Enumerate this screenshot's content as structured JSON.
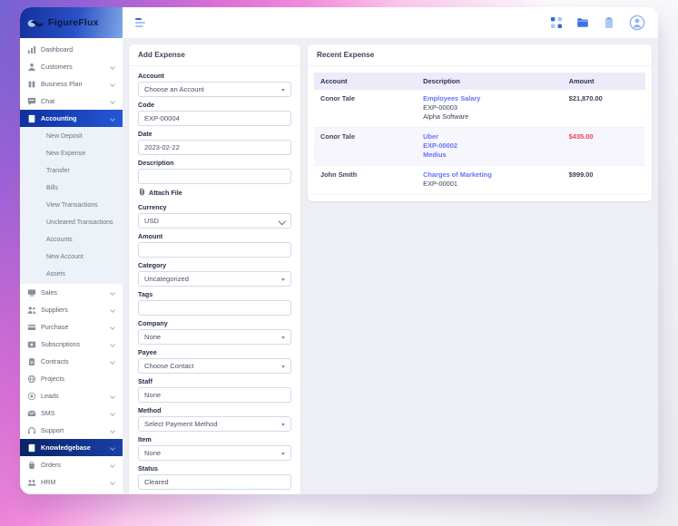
{
  "header": {
    "logo_text": "FigureFlux",
    "toolbar_icons": [
      "apps-icon",
      "folder-icon",
      "clipboard-icon",
      "profile-icon"
    ]
  },
  "sidebar": {
    "items": [
      {
        "label": "Dashboard",
        "icon": "chart-bar-icon",
        "expandable": false
      },
      {
        "label": "Customers",
        "icon": "user-icon",
        "expandable": true
      },
      {
        "label": "Business Plan",
        "icon": "columns-icon",
        "expandable": true
      },
      {
        "label": "Chat",
        "icon": "chat-icon",
        "expandable": true
      },
      {
        "label": "Accounting",
        "icon": "calculator-icon",
        "expandable": true,
        "active": true,
        "children": [
          "New Deposit",
          "New Expense",
          "Transfer",
          "Bills",
          "View Transactions",
          "Uncleared Transactions",
          "Accounts",
          "New Account",
          "Assets"
        ]
      },
      {
        "label": "Sales",
        "icon": "monitor-icon",
        "expandable": true
      },
      {
        "label": "Suppliers",
        "icon": "people-icon",
        "expandable": true
      },
      {
        "label": "Purchase",
        "icon": "credit-card-icon",
        "expandable": true
      },
      {
        "label": "Subscriptions",
        "icon": "screen-icon",
        "expandable": true
      },
      {
        "label": "Contracts",
        "icon": "clipboard-check-icon",
        "expandable": true
      },
      {
        "label": "Projects",
        "icon": "globe-icon",
        "expandable": false
      },
      {
        "label": "Leads",
        "icon": "target-icon",
        "expandable": true
      },
      {
        "label": "SMS",
        "icon": "envelope-icon",
        "expandable": true
      },
      {
        "label": "Support",
        "icon": "headset-icon",
        "expandable": true
      },
      {
        "label": "Knowledgebase",
        "icon": "book-icon",
        "expandable": true,
        "active": true,
        "variant": "dark"
      },
      {
        "label": "Orders",
        "icon": "bag-icon",
        "expandable": true
      },
      {
        "label": "HRM",
        "icon": "team-icon",
        "expandable": true
      }
    ]
  },
  "form": {
    "title": "Add Expense",
    "fields": [
      {
        "label": "Account",
        "control": "select",
        "value": "Choose an Account"
      },
      {
        "label": "Code",
        "control": "input",
        "value": "EXP-00004"
      },
      {
        "label": "Date",
        "control": "input",
        "value": "2023-02-22"
      },
      {
        "label": "Description",
        "control": "input",
        "value": ""
      },
      {
        "label": "Attach File",
        "control": "attach",
        "icon": "paperclip-icon"
      },
      {
        "label": "Currency",
        "control": "select2",
        "value": "USD"
      },
      {
        "label": "Amount",
        "control": "input",
        "value": ""
      },
      {
        "label": "Category",
        "control": "select",
        "value": "Uncategorized"
      },
      {
        "label": "Tags",
        "control": "input",
        "value": ""
      },
      {
        "label": "Company",
        "control": "select",
        "value": "None"
      },
      {
        "label": "Payee",
        "control": "select",
        "value": "Choose Contact"
      },
      {
        "label": "Staff",
        "control": "input",
        "value": "None"
      },
      {
        "label": "Method",
        "control": "select",
        "value": "Select Payment Method"
      },
      {
        "label": "Item",
        "control": "select",
        "value": "None"
      },
      {
        "label": "Status",
        "control": "input",
        "value": "Cleared"
      }
    ]
  },
  "recent": {
    "title": "Recent Expense",
    "columns": [
      "Account",
      "Description",
      "Amount"
    ],
    "rows": [
      {
        "account": "Conor Tale",
        "description_lines": [
          {
            "text": "Employees Salary",
            "link": true
          },
          {
            "text": "EXP-00003",
            "link": false
          },
          {
            "text": "Alpha Software",
            "link": false
          }
        ],
        "amount": "$21,870.00",
        "negative": false
      },
      {
        "account": "Conor Tale",
        "description_lines": [
          {
            "text": "Uber",
            "link": true
          },
          {
            "text": "EXP-00002",
            "link": true
          },
          {
            "text": "Medius",
            "link": true
          }
        ],
        "amount": "$435.00",
        "negative": true
      },
      {
        "account": "John Smith",
        "description_lines": [
          {
            "text": "Charges of Marketing",
            "link": true
          },
          {
            "text": "EXP-00001",
            "link": false
          }
        ],
        "amount": "$999.00",
        "negative": false
      }
    ]
  },
  "colors": {
    "sidebar_active_from": "#10309f",
    "sidebar_active_to": "#2357d6",
    "link": "#6571ff",
    "negative": "#ef3d5b",
    "accent_blue": "#3566dd"
  }
}
